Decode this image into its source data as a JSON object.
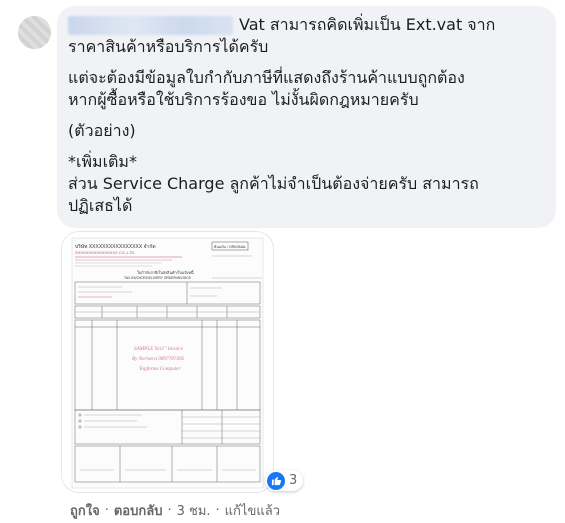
{
  "comment": {
    "text_lines": [
      "Vat สามารถคิดเพิ่มเป็น Ext.vat จาก",
      "ราคาสินค้าหรือบริการได้ครับ",
      "แต่จะต้องมีข้อมูลใบกำกับภาษีที่แสดงถึงร้านค้าแบบถูกต้อง",
      "หากผู้ซื้อหรือใช้บริการร้องขอ ไม่งั้นผิดกฎหมายครับ",
      "(ตัวอย่าง)",
      "*เพิ่มเติม*",
      "ส่วน Service Charge ลูกค้าไม่จำเป็นต้องจ่ายครับ สามารถ",
      "ปฏิเสธได้"
    ]
  },
  "attachment": {
    "doc_header": "บริษัท XXXXXXXXXXXXXXXX จำกัด",
    "doc_header_en": "XXXXXXXXXXXXXXXX CO.,LTD.",
    "doc_badge": "ต้นฉบับ / ORIGINAL",
    "doc_title": "ใบกำกับภาษี/ใบส่งสินค้า/ใบแจ้งหนี้",
    "doc_title_en": "TAX INVOICE/DELIVERY ORDER/INVOICE",
    "watermark_lines": [
      "SAMPLE 9x11\" Invoice",
      "By Nerisera 0897787495",
      "Topforms Computer"
    ]
  },
  "reactions": {
    "icon": "like-icon",
    "count": "3"
  },
  "actions": {
    "like": "ถูกใจ",
    "reply": "ตอบกลับ",
    "time": "3 ชม.",
    "edited": "แก้ไขแล้ว",
    "separator": "·"
  }
}
